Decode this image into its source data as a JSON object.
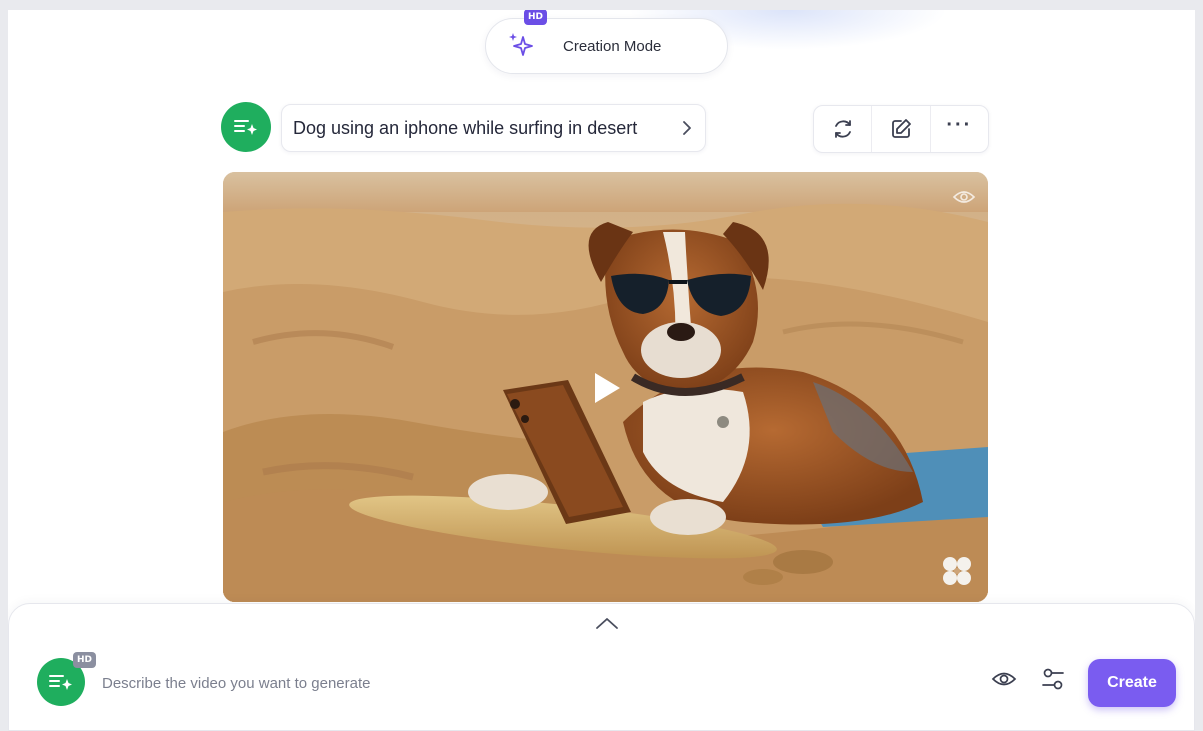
{
  "mode": {
    "badge": "HD",
    "label": "Creation Mode",
    "icon": "sparkle-icon",
    "accent": "#6b4ee6"
  },
  "prompt": {
    "text": "Dog using an iphone while surfing in desert",
    "avatar_icon": "prompt-generate-icon",
    "chevron_icon": "chevron-right-icon"
  },
  "actions": [
    {
      "icon": "regenerate-icon"
    },
    {
      "icon": "edit-icon"
    },
    {
      "icon": "more-options-icon",
      "label": "···"
    }
  ],
  "video": {
    "visibility_icon": "eye-icon",
    "play_icon": "play-icon",
    "watermark_icon": "brand-logo-icon"
  },
  "composer": {
    "badge": "HD",
    "placeholder": "Describe the video you want to generate",
    "expand_icon": "chevron-up-icon",
    "preview_icon": "eye-icon",
    "settings_icon": "sliders-icon",
    "create_label": "Create",
    "create_color": "#7a5cf0",
    "avatar_color": "#1fae5e"
  }
}
